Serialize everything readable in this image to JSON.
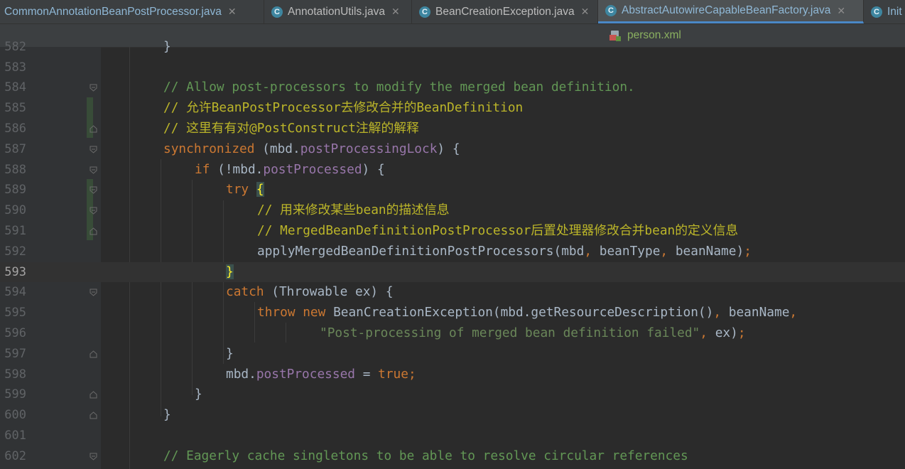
{
  "tabs": [
    {
      "label": "CommonAnnotationBeanPostProcessor.java",
      "icon": "C",
      "active": false
    },
    {
      "label": "AnnotationUtils.java",
      "icon": "C",
      "active": false
    },
    {
      "label": "BeanCreationException.java",
      "icon": "C",
      "active": false
    },
    {
      "label": "AbstractAutowireCapableBeanFactory.java",
      "icon": "C",
      "active": true
    },
    {
      "label": "Init",
      "icon": "C",
      "active": false
    }
  ],
  "subtab": {
    "label": "person.xml",
    "icon": "xml-file-icon"
  },
  "editor": {
    "current_line": "593",
    "lines": [
      {
        "num": "582",
        "code": "}"
      },
      {
        "num": "583",
        "code": ""
      },
      {
        "num": "584",
        "code": "// Allow post-processors to modify the merged bean definition."
      },
      {
        "num": "585",
        "code": "// 允许BeanPostProcessor去修改合并的BeanDefinition"
      },
      {
        "num": "586",
        "code": "// 这里有有对@PostConstruct注解的解释"
      },
      {
        "num": "587",
        "code": "synchronized (mbd.postProcessingLock) {"
      },
      {
        "num": "588",
        "code": "if (!mbd.postProcessed) {"
      },
      {
        "num": "589",
        "code": "try {"
      },
      {
        "num": "590",
        "code": "// 用来修改某些bean的描述信息"
      },
      {
        "num": "591",
        "code": "// MergedBeanDefinitionPostProcessor后置处理器修改合并bean的定义信息"
      },
      {
        "num": "592",
        "code": "applyMergedBeanDefinitionPostProcessors(mbd, beanType, beanName);"
      },
      {
        "num": "593",
        "code": "}"
      },
      {
        "num": "594",
        "code": "catch (Throwable ex) {"
      },
      {
        "num": "595",
        "code": "throw new BeanCreationException(mbd.getResourceDescription(), beanName,"
      },
      {
        "num": "596",
        "code": "\"Post-processing of merged bean definition failed\", ex);"
      },
      {
        "num": "597",
        "code": "}"
      },
      {
        "num": "598",
        "code": "mbd.postProcessed = true;"
      },
      {
        "num": "599",
        "code": "}"
      },
      {
        "num": "600",
        "code": "}"
      },
      {
        "num": "601",
        "code": ""
      },
      {
        "num": "602",
        "code": "// Eagerly cache singletons to be able to resolve circular references"
      }
    ]
  },
  "colors": {
    "background": "#2b2b2b",
    "gutter": "#313335",
    "keyword": "#cc7832",
    "comment": "#808080",
    "field": "#9876aa",
    "string": "#6a8759",
    "text": "#a9b7c6"
  }
}
